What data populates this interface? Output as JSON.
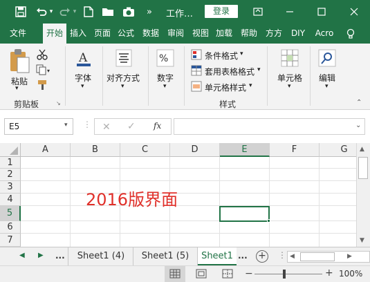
{
  "titlebar": {
    "title": "工作…",
    "login_label": "登录",
    "accent": "#217346"
  },
  "tabs": [
    {
      "label": "文件"
    },
    {
      "label": "开始"
    },
    {
      "label": "插入"
    },
    {
      "label": "页面"
    },
    {
      "label": "公式"
    },
    {
      "label": "数据"
    },
    {
      "label": "审阅"
    },
    {
      "label": "视图"
    },
    {
      "label": "加载"
    },
    {
      "label": "帮助"
    },
    {
      "label": "方方"
    },
    {
      "label": "DIY"
    },
    {
      "label": "Acro"
    }
  ],
  "ribbon": {
    "paste_label": "粘贴",
    "clipboard_group": "剪贴板",
    "font_label": "字体",
    "align_label": "对齐方式",
    "number_label": "数字",
    "style_items": [
      {
        "label": "条件格式"
      },
      {
        "label": "套用表格格式"
      },
      {
        "label": "单元格样式"
      }
    ],
    "style_group": "样式",
    "cells_label": "单元格",
    "edit_label": "编辑"
  },
  "formula_bar": {
    "name_box": "E5",
    "fx": "fx",
    "formula": ""
  },
  "grid": {
    "columns": [
      "A",
      "B",
      "C",
      "D",
      "E",
      "F",
      "G"
    ],
    "rows": [
      "1",
      "2",
      "3",
      "4",
      "5",
      "6",
      "7"
    ],
    "selected_cell": "E5",
    "overlay_text": "2016版界面",
    "overlay_color": "#e0302a"
  },
  "sheets": {
    "ellipsis": "...",
    "tabs": [
      {
        "label": "Sheet1 (4)"
      },
      {
        "label": "Sheet1 (5)"
      },
      {
        "label": "Sheet1"
      }
    ]
  },
  "status": {
    "zoom": "100%"
  }
}
